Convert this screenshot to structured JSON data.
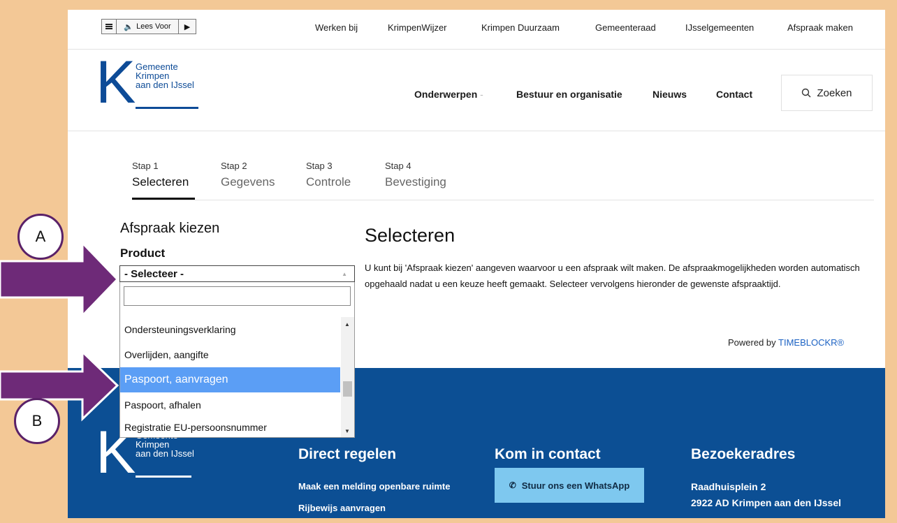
{
  "readbar": {
    "lees_label": "Lees Voor"
  },
  "toplinks": [
    "Werken bij",
    "KrimpenWijzer",
    "Krimpen Duurzaam",
    "Gemeenteraad",
    "IJsselgemeenten",
    "Afspraak maken"
  ],
  "logo": {
    "letter": "K",
    "line1": "Gemeente",
    "line2": "Krimpen",
    "line3": "aan den IJssel"
  },
  "nav": {
    "onderwerpen": "Onderwerpen",
    "bestuur": "Bestuur en organisatie",
    "nieuws": "Nieuws",
    "contact": "Contact",
    "zoeken": "Zoeken"
  },
  "steps": [
    {
      "num": "Stap 1",
      "label": "Selecteren"
    },
    {
      "num": "Stap 2",
      "label": "Gegevens"
    },
    {
      "num": "Stap 3",
      "label": "Controle"
    },
    {
      "num": "Stap 4",
      "label": "Bevestiging"
    }
  ],
  "form": {
    "heading": "Afspraak kiezen",
    "product_label": "Product",
    "select_value": "- Selecteer -",
    "options": [
      "Ondersteuningsverklaring",
      "Overlijden, aangifte",
      "Paspoort, aanvragen",
      "Paspoort, afhalen",
      "Registratie EU-persoonsnummer"
    ],
    "selected_option": "Paspoort, aanvragen"
  },
  "main": {
    "heading": "Selecteren",
    "intro": "U kunt bij 'Afspraak kiezen' aangeven waarvoor u een afspraak wilt maken. De afspraakmogelijkheden worden automatisch opgehaald nadat u een keuze heeft gemaakt. Selecteer vervolgens hieronder de gewenste afspraaktijd.",
    "powered_prefix": "Powered by ",
    "powered_brand": "TIMEBLOCKR®"
  },
  "footer": {
    "col1_title": "Direct regelen",
    "col1_link1": "Maak een melding openbare ruimte",
    "col1_link2": "Rijbewijs aanvragen",
    "col2_title": "Kom in contact",
    "whatsapp": "Stuur ons een WhatsApp",
    "col3_title": "Bezoekeradres",
    "addr1": "Raadhuisplein 2",
    "addr2": "2922 AD Krimpen aan den IJssel"
  },
  "annotations": {
    "a": "A",
    "b": "B"
  },
  "colors": {
    "brand_blue": "#0d4b97",
    "footer_blue": "#0c4f94",
    "highlight": "#5b9ef5",
    "arrow_purple": "#6e2a78",
    "frame": "#f3c896",
    "whatsapp_bg": "#7ec8ef"
  }
}
